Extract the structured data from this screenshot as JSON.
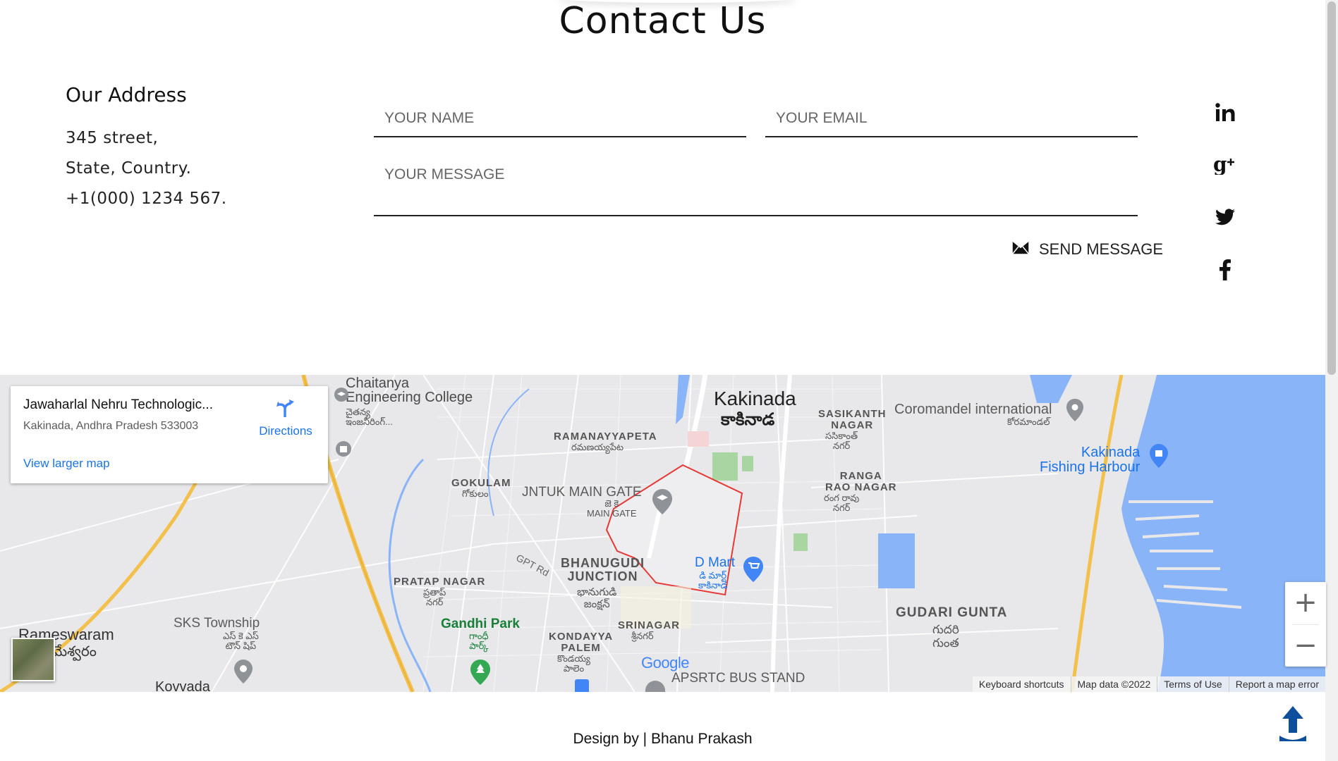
{
  "page_title": "Contact Us",
  "address": {
    "heading": "Our Address",
    "lines": [
      "345 street,",
      "State, Country.",
      "+1(000) 1234 567."
    ]
  },
  "form": {
    "name_placeholder": "YOUR NAME",
    "email_placeholder": "YOUR EMAIL",
    "message_placeholder": "YOUR MESSAGE",
    "send_label": "SEND MESSAGE"
  },
  "social": [
    "linkedin-icon",
    "google-plus-icon",
    "twitter-icon",
    "facebook-icon"
  ],
  "map": {
    "card": {
      "title": "Jawaharlal Nehru Technologic...",
      "address": "Kakinada, Andhra Pradesh 533003",
      "directions": "Directions",
      "view_larger": "View larger map"
    },
    "labels": {
      "chaitanya": "Chaitanya\nEngineering College",
      "chaitanya_te": "చైతన్య\nఇంజనీరింగ్...",
      "kakinada": "Kakinada",
      "kakinada_te": "కాకినాడ",
      "ramanayyapeta": "RAMANAYYAPETA",
      "ramanayyapeta_te": "రమణయ్యపేట",
      "sasikanth": "SASIKANTH\nNAGAR",
      "sasikanth_te": "ససికాంత్\nనగర్",
      "coromandel": "Coromandel international",
      "coromandel_te": "కోరమాండల్",
      "fishing": "Kakinada\nFishing Harbour",
      "gokulam": "GOKULAM",
      "gokulam_te": "గోకులం",
      "jntuk": "JNTUK MAIN GATE",
      "jntuk_te": "జె కె\nMAIN GATE",
      "ranga": "RANGA\nRAO NAGAR",
      "ranga_te": "రంగ రావు\nనగర్",
      "gpt": "GPT Rd",
      "bhanugudi": "BHANUGUDI\nJUNCTION",
      "bhanugudi_te": "భానుగుడి\nజంక్షన్",
      "pratap": "PRATAP NAGAR",
      "pratap_te": "ప్రతాప్\nనగర్",
      "dmart": "D Mart",
      "dmart_te": "డి మార్ట్\nకాకినాడ",
      "gudari": "GUDARI GUNTA",
      "gudari_te": "గుదరి\nగుంత",
      "sks": "SKS Township",
      "sks_te": "ఎస్ కె ఎస్\nటౌన్ షిప్",
      "rameswaram": "Rameswaram",
      "rameswaram_te": "మేశ్వరం",
      "gandhi": "Gandhi Park",
      "gandhi_te": "గాంధీ\nపార్క్",
      "kondayya": "KONDAYYA\nPALEM",
      "kondayya_te": "కొండయ్య\nపాలెం",
      "srinagar": "SRINAGAR",
      "srinagar_te": "శ్రీనగర్",
      "apsrtc": "APSRTC BUS STAND",
      "kovvada": "Kovvada",
      "google": "Google"
    },
    "attribution": [
      "Keyboard shortcuts",
      "Map data ©2022",
      "Terms of Use",
      "Report a map error"
    ]
  },
  "footer": {
    "credit": "Design by | Bhanu Prakash"
  },
  "colors": {
    "map_road": "#f3c14b",
    "map_water": "#8ab4f8",
    "map_park": "#a8d5a2",
    "link": "#1a73e8"
  }
}
